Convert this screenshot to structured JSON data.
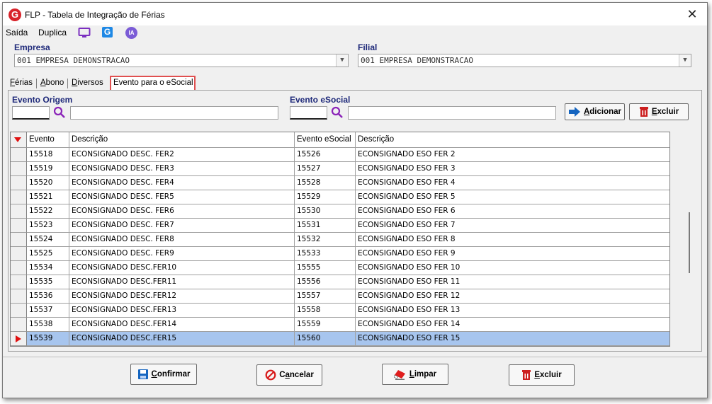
{
  "window": {
    "title": "FLP - Tabela de Integração de Férias",
    "logo_letter": "G",
    "close_glyph": "✕"
  },
  "toolbar": {
    "items": [
      "Saída",
      "Duplica"
    ],
    "icons": [
      "monitor-icon",
      "g-app-icon",
      "ia-icon"
    ],
    "ia_label": "IA",
    "g_label": "G"
  },
  "filters": {
    "empresa_label": "Empresa",
    "empresa_value": "001 EMPRESA DEMONSTRACAO",
    "filial_label": "Filial",
    "filial_value": "001 EMPRESA DEMONSTRACAO"
  },
  "tabs": [
    {
      "label": "Férias",
      "underline": "F",
      "rest": "érias"
    },
    {
      "label": "Abono",
      "underline": "A",
      "rest": "bono"
    },
    {
      "label": "Diversos",
      "underline": "D",
      "rest": "iversos"
    },
    {
      "label": "Evento para o eSocial",
      "active": true
    }
  ],
  "panel": {
    "evento_origem_label": "Evento Origem",
    "evento_esocial_label": "Evento eSocial",
    "adicionar": {
      "underline": "A",
      "rest": "dicionar"
    },
    "excluir": {
      "underline": "E",
      "rest": "xcluir"
    }
  },
  "grid": {
    "columns": [
      "Evento",
      "Descrição",
      "Evento eSocial",
      "Descrição"
    ],
    "rows": [
      [
        "15518",
        "ECONSIGNADO DESC. FER2",
        "15526",
        "ECONSIGNADO ESO FER 2"
      ],
      [
        "15519",
        "ECONSIGNADO DESC. FER3",
        "15527",
        "ECONSIGNADO ESO FER 3"
      ],
      [
        "15520",
        "ECONSIGNADO DESC. FER4",
        "15528",
        "ECONSIGNADO ESO FER 4"
      ],
      [
        "15521",
        "ECONSIGNADO DESC. FER5",
        "15529",
        "ECONSIGNADO ESO FER 5"
      ],
      [
        "15522",
        "ECONSIGNADO DESC. FER6",
        "15530",
        "ECONSIGNADO ESO FER 6"
      ],
      [
        "15523",
        "ECONSIGNADO DESC. FER7",
        "15531",
        "ECONSIGNADO ESO FER 7"
      ],
      [
        "15524",
        "ECONSIGNADO DESC. FER8",
        "15532",
        "ECONSIGNADO ESO FER 8"
      ],
      [
        "15525",
        "ECONSIGNADO DESC. FER9",
        "15533",
        "ECONSIGNADO ESO FER 9"
      ],
      [
        "15534",
        "ECONSIGNADO DESC.FER10",
        "15555",
        "ECONSIGNADO ESO FER 10"
      ],
      [
        "15535",
        "ECONSIGNADO DESC.FER11",
        "15556",
        "ECONSIGNADO ESO FER 11"
      ],
      [
        "15536",
        "ECONSIGNADO DESC.FER12",
        "15557",
        "ECONSIGNADO ESO FER 12"
      ],
      [
        "15537",
        "ECONSIGNADO DESC.FER13",
        "15558",
        "ECONSIGNADO ESO FER 13"
      ],
      [
        "15538",
        "ECONSIGNADO DESC.FER14",
        "15559",
        "ECONSIGNADO ESO FER 14"
      ],
      [
        "15539",
        "ECONSIGNADO DESC.FER15",
        "15560",
        "ECONSIGNADO ESO FER 15"
      ]
    ],
    "selected_row": 13
  },
  "footer": {
    "confirmar": {
      "underline": "C",
      "rest": "onfirmar"
    },
    "cancelar": {
      "pre": "C",
      "underline": "a",
      "rest": "ncelar"
    },
    "limpar": {
      "underline": "L",
      "rest": "impar"
    },
    "excluir": {
      "underline": "E",
      "rest": "xcluir"
    }
  },
  "colors": {
    "brand_red": "#d8232a",
    "accent_purple": "#7b2fc0",
    "selection": "#a7c5ee",
    "label_blue": "#1f2a7a"
  }
}
